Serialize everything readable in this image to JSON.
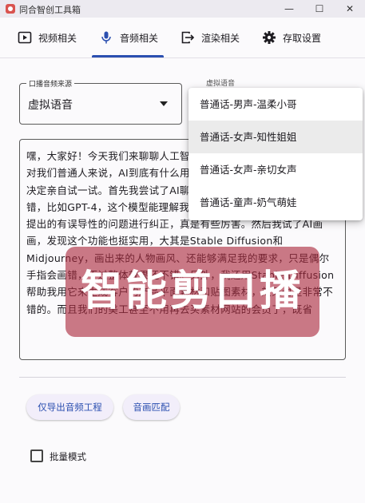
{
  "window": {
    "title": "同合智创工具箱",
    "minimize": "—",
    "maximize": "☐",
    "close": "✕"
  },
  "tabs": [
    {
      "label": "视频相关",
      "icon": "play-box-icon"
    },
    {
      "label": "音频相关",
      "icon": "microphone-icon",
      "active": true
    },
    {
      "label": "渲染相关",
      "icon": "export-icon"
    },
    {
      "label": "存取设置",
      "icon": "gear-icon"
    }
  ],
  "audio_source": {
    "label": "口播音频来源",
    "value": "虚拟语音"
  },
  "voice_select": {
    "label": "虚拟语音"
  },
  "voice_options": [
    {
      "label": "普通话-男声-温柔小哥"
    },
    {
      "label": "普通话-女声-知性姐姐",
      "selected": true
    },
    {
      "label": "普通话-女声-亲切女声"
    },
    {
      "label": "普通话-童声-奶气萌娃"
    }
  ],
  "script_text": "嘿，大家好！今天我们来聊聊人工智能的使用体验。我一直在思考，对我们普通人来说，AI到底有什么用呢？就为了搞清楚这个问题，我决定亲自试一试。首先我尝试了AI聊天，发现它的理解能力还挺不错，比如GPT-4，这个模型能理解我的语言中隐藏的逻辑，甚至对我提出的有误导性的问题进行纠正，真是有些厉害。然后我试了AI画画，发现这个功能也挺实用，大其是Stable Diffusion和Midjourney，画出来的人物画风、还能够满足我的要求，只是偶尔手指会画错，不过整体效果还不错。另外，我还用Stable Diffusion帮助我用它来生成客户的产品平面素材和贴图素材，效果也是非常不错的。而且我们的美工甚至不用再去买素材网站的会员了，既省",
  "buttons": {
    "export_audio": "仅导出音频工程",
    "match_visuals": "音画匹配"
  },
  "batch_mode": {
    "label": "批量模式"
  },
  "watermark": "智能剪口播",
  "colors": {
    "accent": "#2b4fb0",
    "watermark_bg": "#aa283c"
  }
}
